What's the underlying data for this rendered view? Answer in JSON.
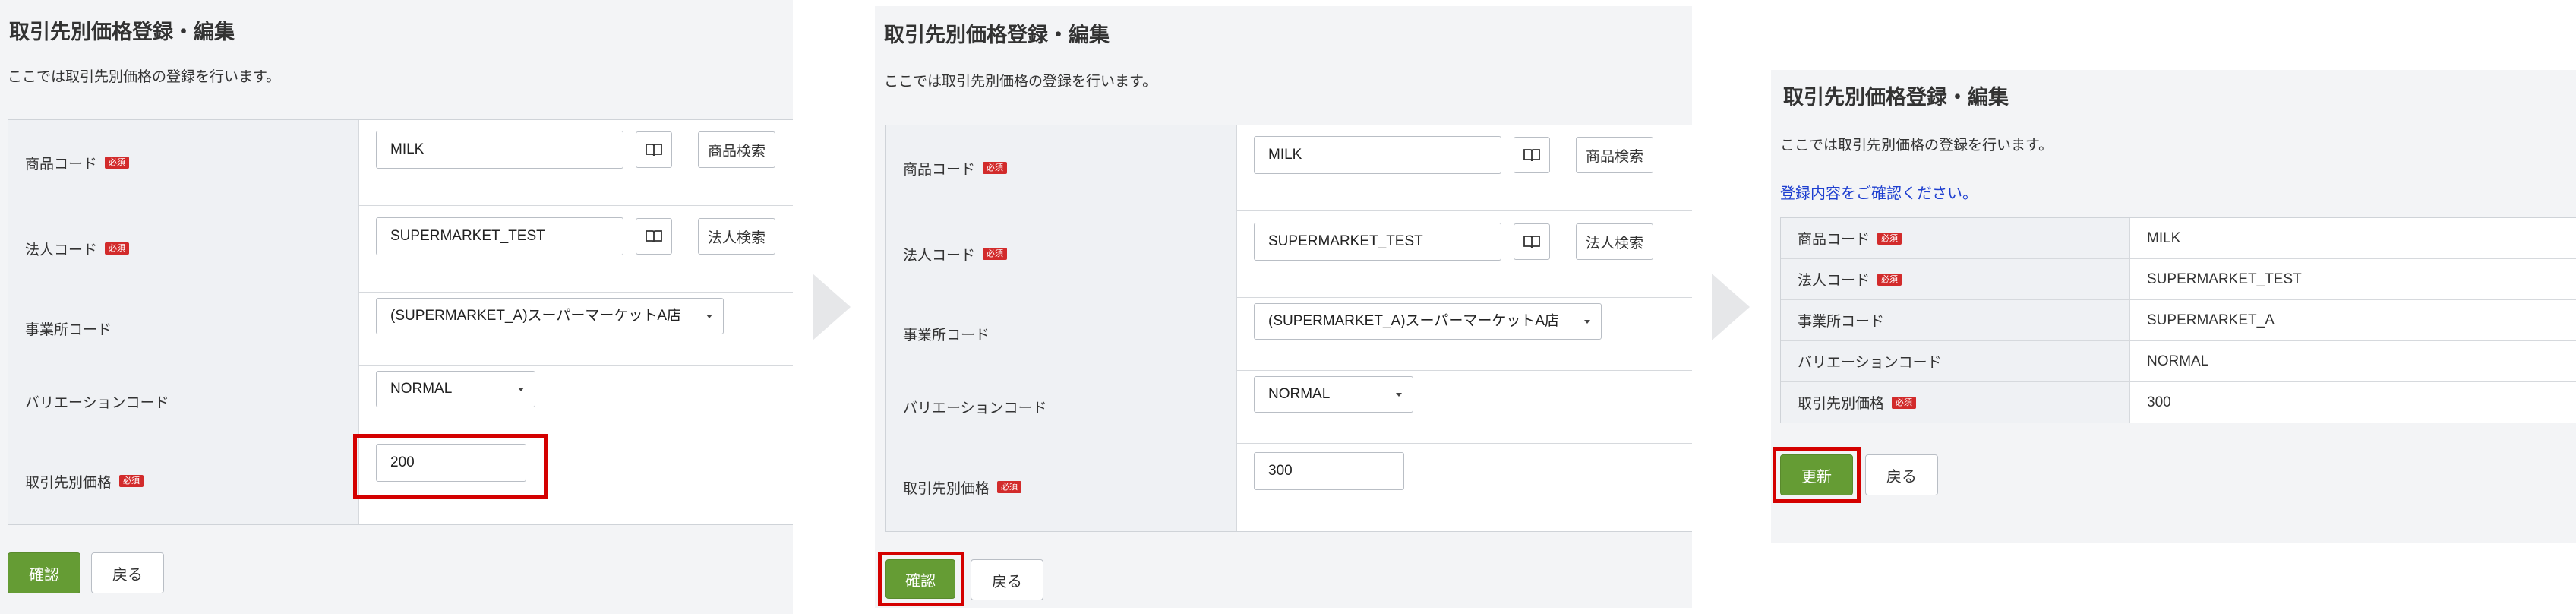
{
  "screen_title": "取引先別価格登録・編集",
  "screen_desc": "ここでは取引先別価格の登録を行います。",
  "confirm_notice": "登録内容をご確認ください。",
  "required_badge": "必須",
  "labels": {
    "product_code": "商品コード",
    "corp_code": "法人コード",
    "office_code": "事業所コード",
    "variation_code": "バリエーションコード",
    "price": "取引先別価格"
  },
  "buttons": {
    "product_search": "商品検索",
    "corp_search": "法人検索",
    "confirm": "確認",
    "back": "戻る",
    "update": "更新"
  },
  "icons": {
    "book": "book-icon",
    "caret": "chevron-down-icon",
    "arrow": "arrow-right-icon"
  },
  "colors": {
    "required": "#d22b2b",
    "primary": "#659c34",
    "highlight": "#d40000",
    "notice": "#1e3fd0"
  },
  "step1": {
    "product_code": "MILK",
    "corp_code": "SUPERMARKET_TEST",
    "office_select": "(SUPERMARKET_A)スーパーマーケットA店",
    "variation_select": "NORMAL",
    "price": "200"
  },
  "step2": {
    "product_code": "MILK",
    "corp_code": "SUPERMARKET_TEST",
    "office_select": "(SUPERMARKET_A)スーパーマーケットA店",
    "variation_select": "NORMAL",
    "price": "300"
  },
  "step3": {
    "product_code": "MILK",
    "corp_code": "SUPERMARKET_TEST",
    "office_code": "SUPERMARKET_A",
    "variation_code": "NORMAL",
    "price": "300"
  }
}
